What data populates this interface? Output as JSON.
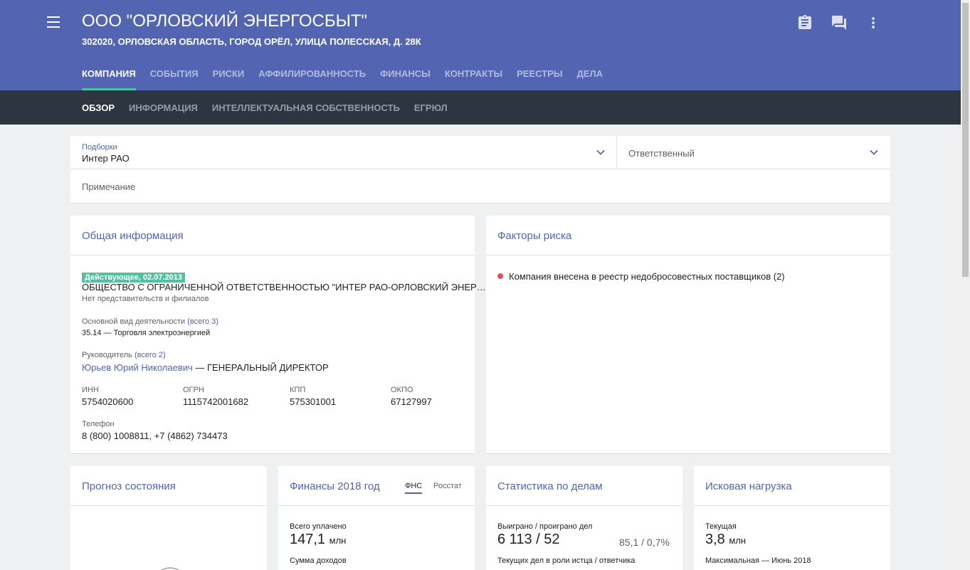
{
  "header": {
    "title": "ООО \"ОРЛОВСКИЙ ЭНЕРГОСБЫТ\"",
    "address": "302020, ОРЛОВСКАЯ ОБЛАСТЬ, ГОРОД ОРЁЛ, УЛИЦА ПОЛЕССКАЯ, Д. 28К",
    "tabs": [
      "КОМПАНИЯ",
      "СОБЫТИЯ",
      "РИСКИ",
      "АФФИЛИРОВАННОСТЬ",
      "ФИНАНСЫ",
      "КОНТРАКТЫ",
      "РЕЕСТРЫ",
      "ДЕЛА"
    ],
    "icons": [
      "clipboard-icon",
      "chat-icon",
      "more-vert-icon"
    ]
  },
  "subnav": {
    "tabs": [
      "ОБЗОР",
      "ИНФОРМАЦИЯ",
      "ИНТЕЛЛЕКТУАЛЬНАЯ СОБСТВЕННОСТЬ",
      "ЕГРЮЛ"
    ]
  },
  "filters": {
    "collections_label": "Подборки",
    "collections_value": "Интер РАО",
    "responsible_placeholder": "Ответственный",
    "note_placeholder": "Примечание"
  },
  "general": {
    "title": "Общая информация",
    "status": "Действующее, 02.07.2013",
    "full_name": "ОБЩЕСТВО С ОГРАНИЧЕННОЙ ОТВЕТСТВЕННОСТЬЮ \"ИНТЕР РАО-ОРЛОВСКИЙ ЭНЕР…",
    "branches": "Нет представительств и филиалов",
    "activity_label": "Основной вид деятельности",
    "activity_total": "(всего 3)",
    "activity_value": "35.14 — Торговля электроэнергией",
    "head_label": "Руководитель",
    "head_total": "(всего 2)",
    "head_name": "Юрьев Юрий Николаевич",
    "head_position": " — ГЕНЕРАЛЬНЫЙ ДИРЕКТОР",
    "codes": [
      {
        "label": "ИНН",
        "value": "5754020600"
      },
      {
        "label": "ОГРН",
        "value": "1115742001682"
      },
      {
        "label": "КПП",
        "value": "575301001"
      },
      {
        "label": "ОКПО",
        "value": "67127997"
      }
    ],
    "phone_label": "Телефон",
    "phone_value": "8 (800) 1008811, +7 (4862) 734473"
  },
  "risks": {
    "title": "Факторы риска",
    "items": [
      "Компания внесена в реестр недобросовестных поставщиков (2)"
    ],
    "dot_color": "#e84e5f"
  },
  "forecast": {
    "title": "Прогноз состояния"
  },
  "finance": {
    "title": "Финансы 2018 год",
    "tabs": [
      "ФНС",
      "Росстат"
    ],
    "paid_label": "Всего уплачено",
    "paid_value": "147,1",
    "paid_unit": "млн",
    "income_label": "Сумма доходов"
  },
  "cases": {
    "title": "Статистика по делам",
    "wl_label": "Выиграно / проиграно дел",
    "wl_value": "6 113 / 52",
    "wl_pct": "85,1 / 0,7%",
    "current_label": "Текущих дел в роли истца / ответчика"
  },
  "claims": {
    "title": "Исковая нагрузка",
    "current_label": "Текущая",
    "current_value": "3,8",
    "current_unit": "млн",
    "max_label": "Максимальная — Июнь 2018"
  },
  "colors": {
    "header": "#5364b2",
    "subnav": "#2d3540",
    "accent": "#4fc3a1",
    "link": "#5364b2",
    "risk": "#e84e5f"
  }
}
